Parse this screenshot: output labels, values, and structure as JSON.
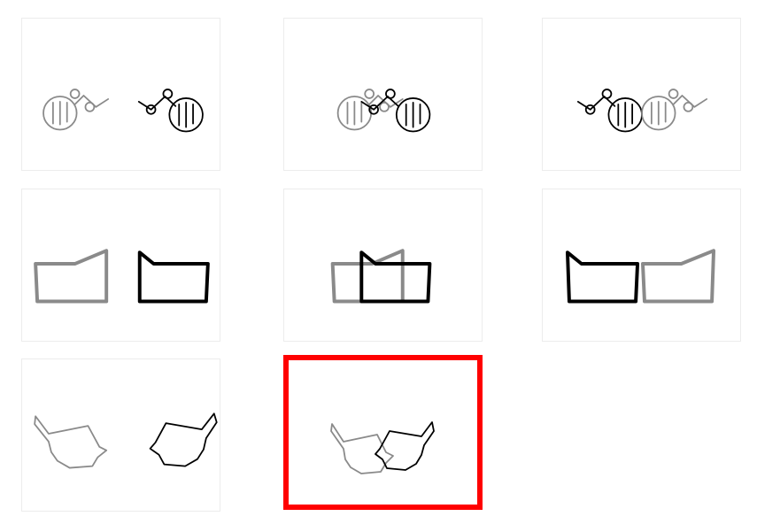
{
  "puzzle": {
    "rows": [
      {
        "shape": "ring-chain",
        "panels": [
          "left-right",
          "overlap",
          "swapped"
        ]
      },
      {
        "shape": "trapezoid-frame",
        "panels": [
          "left-right",
          "overlap",
          "swapped"
        ]
      },
      {
        "shape": "leaf-cup",
        "panels": [
          "left-right",
          "overlap-answer"
        ]
      }
    ],
    "selected_panel": "row3-col2",
    "colors": {
      "gray_stroke": "#8a8a8a",
      "black_stroke": "#000000",
      "selection_border": "#ff0000",
      "panel_border": "#ececec"
    }
  }
}
